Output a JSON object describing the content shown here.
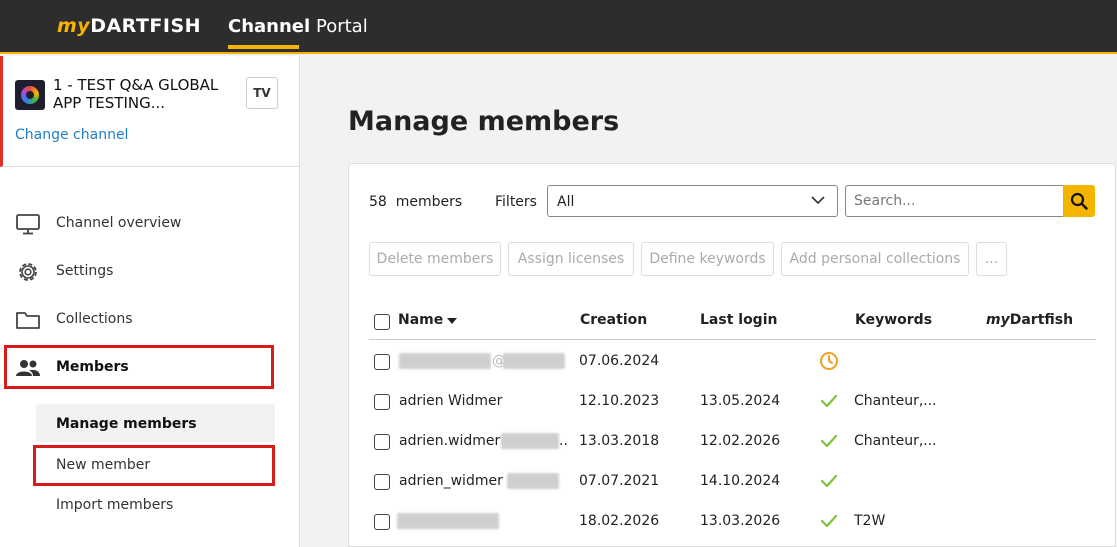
{
  "topbar": {
    "logo_prefix": "my",
    "logo_main": "DARTFISH",
    "nav": [
      {
        "label": "Channel",
        "active": true
      },
      {
        "label": "Portal",
        "active": false
      }
    ]
  },
  "sidebar": {
    "channel": {
      "name": "1 - TEST Q&A GLOBAL APP TESTING...",
      "badge": "TV",
      "change_link": "Change channel"
    },
    "nav": [
      {
        "label": "Channel overview",
        "icon": "monitor-icon"
      },
      {
        "label": "Settings",
        "icon": "gear-icon"
      },
      {
        "label": "Collections",
        "icon": "folder-icon"
      },
      {
        "label": "Members",
        "icon": "users-icon",
        "active": true
      }
    ],
    "sub_nav": [
      {
        "label": "Manage members",
        "selected": true
      },
      {
        "label": "New member"
      },
      {
        "label": "Import members"
      }
    ]
  },
  "main": {
    "title": "Manage members",
    "count_value": "58",
    "count_label": "members",
    "filters_label": "Filters",
    "filter_value": "All",
    "search_placeholder": "Search...",
    "actions": [
      "Delete members",
      "Assign licenses",
      "Define keywords",
      "Add personal collections",
      "..."
    ],
    "columns": {
      "name": "Name",
      "creation": "Creation",
      "last_login": "Last login",
      "keywords": "Keywords",
      "mydartfish_prefix": "my",
      "mydartfish_main": "Dartfish"
    },
    "rows": [
      {
        "name": "@",
        "creation": "07.06.2024",
        "last_login": "",
        "status": "pending",
        "keywords": ""
      },
      {
        "name": "adrien Widmer",
        "creation": "12.10.2023",
        "last_login": "13.05.2024",
        "status": "active",
        "keywords": "Chanteur,..."
      },
      {
        "name": "adrien.widmer",
        "creation": "13.03.2018",
        "last_login": "12.02.2026",
        "status": "active",
        "keywords": "Chanteur,..."
      },
      {
        "name": "adrien_widmer",
        "creation": "07.07.2021",
        "last_login": "14.10.2024",
        "status": "active",
        "keywords": ""
      },
      {
        "name": "",
        "creation": "18.02.2026",
        "last_login": "13.03.2026",
        "status": "active",
        "keywords": "T2W"
      }
    ]
  },
  "colors": {
    "accent": "#f5b400",
    "link": "#1f7fc4",
    "highlight_box": "#d81b1b",
    "check": "#7cc242",
    "pending": "#f0a020"
  }
}
